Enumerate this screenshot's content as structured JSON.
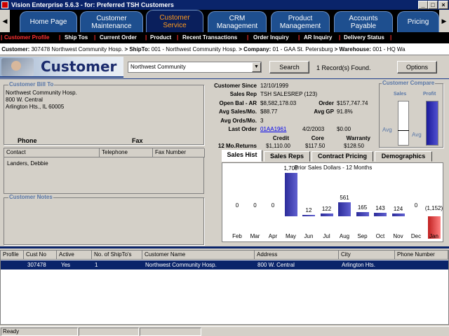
{
  "window": {
    "title": "Vision Enterprise 5.6.3 - for: Preferred TSH Customers"
  },
  "nav": {
    "tabs": [
      {
        "label": "Home Page"
      },
      {
        "label": "Customer\nMaintenance"
      },
      {
        "label": "Customer\nService"
      },
      {
        "label": "CRM\nManagement"
      },
      {
        "label": "Product\nManagement"
      },
      {
        "label": "Accounts\nPayable"
      },
      {
        "label": "Pricing"
      }
    ],
    "active": "Customer Service"
  },
  "subnav": {
    "items": [
      "Customer Profile",
      "Ship Tos",
      "Current Order",
      "Product",
      "Recent Transactions",
      "Order Inquiry",
      "AR Inquiry",
      "Delivery Status"
    ],
    "active": "Customer Profile"
  },
  "breadcrumb": {
    "customer_label": "Customer:",
    "customer": "307478 Northwest Community Hosp.",
    "shipto_label": "> ShipTo:",
    "shipto": "001 - Northwest Community Hosp.",
    "company_label": "> Company:",
    "company": "01 - GAA St. Petersburg",
    "warehouse_label": "> Warehouse:",
    "warehouse": "001 - HQ Wa"
  },
  "header": {
    "title": "Customer",
    "search_value": "Northwest Community",
    "search_button": "Search",
    "records_found": "1 Record(s) Found.",
    "options_button": "Options"
  },
  "bill_to": {
    "legend": "Customer Bill To",
    "name": "Northwest Community Hosp.",
    "address": "800 W. Central",
    "city": "Arlington Hts., IL 60005",
    "phone_label": "Phone",
    "fax_label": "Fax",
    "contact_headers": [
      "Contact",
      "Telephone",
      "Fax Number"
    ],
    "contacts": [
      {
        "contact": "Landers, Debbie",
        "telephone": "",
        "fax": ""
      }
    ]
  },
  "notes": {
    "legend": "Customer Notes"
  },
  "summary": {
    "since_label": "Customer Since",
    "since": "12/10/1999",
    "rep_label": "Sales Rep",
    "rep": "TSH SALESREP (123)",
    "openbal_label": "Open Bal - AR",
    "openbal": "$8,582,178.03",
    "order_label": "Order",
    "order": "$157,747.74",
    "avgsales_label": "Avg Sales/Mo.",
    "avgsales": "$88.77",
    "avggp_label": "Avg GP",
    "avggp": "91.8%",
    "avgords_label": "Avg Ords/Mo.",
    "avgords": "3",
    "lastorder_label": "Last Order",
    "lastorder_no": "01AA1961",
    "lastorder_date": "4/2/2003",
    "lastorder_amt": "$0.00",
    "returns_label": "12 Mo.Returns",
    "credit_label": "Credit",
    "credit": "$1,110.00",
    "core_label": "Core",
    "core": "$117.50",
    "warranty_label": "Warranty",
    "warranty": "$128.50"
  },
  "compare": {
    "legend": "Customer Compare",
    "sales_label": "Sales",
    "profit_label": "Profit",
    "avg_label": "Avg",
    "avg_label2": "Avg",
    "sales_level": 0.5,
    "profit_level": 1.0
  },
  "chart_tabs": [
    "Sales Hist",
    "Sales Reps",
    "Contract Pricing",
    "Demographics"
  ],
  "chart_data": {
    "type": "bar",
    "title": "Prior Sales Dollars - 12 Months",
    "categories": [
      "Feb",
      "Mar",
      "Apr",
      "May",
      "Jun",
      "Jul",
      "Aug",
      "Sep",
      "Oct",
      "Nov",
      "Dec",
      "Jan"
    ],
    "values": [
      0,
      0,
      0,
      1709,
      12,
      122,
      561,
      165,
      143,
      124,
      0,
      -1152
    ],
    "labels": [
      "0",
      "0",
      "0",
      "1,709",
      "12",
      "122",
      "561",
      "165",
      "143",
      "124",
      "0",
      "(1,152)"
    ],
    "colors": {
      "positive": "#3a3ab0",
      "negative": "#e04040"
    }
  },
  "results": {
    "headers": [
      "Profile",
      "Cust No",
      "Active",
      "No. of ShipTo's",
      "Customer Name",
      "Address",
      "City",
      "Phone Number"
    ],
    "rows": [
      {
        "profile": "",
        "cust_no": "307478",
        "active": "Yes",
        "shiptos": "1",
        "name": "Northwest Community Hosp.",
        "address": "800 W. Central",
        "city": "Arlington Hts.",
        "phone": ""
      }
    ]
  },
  "status": {
    "text": "Ready"
  }
}
